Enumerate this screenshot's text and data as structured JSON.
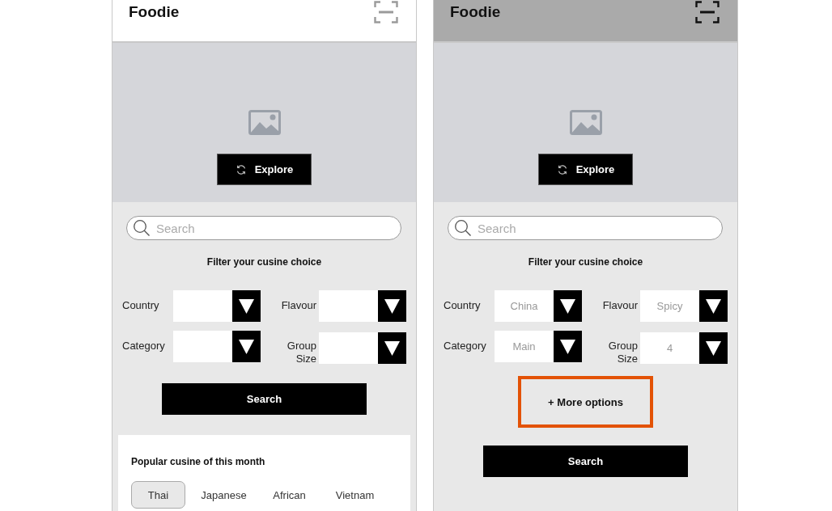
{
  "screens": [
    {
      "header": {
        "title": "Foodie",
        "shaded": false
      },
      "explore_button": "Explore",
      "search": {
        "placeholder": "Search"
      },
      "filter_title": "Filter your cusine choice",
      "filters": [
        {
          "label": "Country"
        },
        {
          "label": "Flavour"
        },
        {
          "label": "Category"
        },
        {
          "label": "Group Size"
        }
      ],
      "search_button": "Search",
      "popular": {
        "title": "Popular cusine of this month",
        "items": [
          {
            "label": "Thai",
            "selected": true
          },
          {
            "label": "Japanese",
            "selected": false
          },
          {
            "label": "African",
            "selected": false
          },
          {
            "label": "Vietnam",
            "selected": false
          }
        ]
      }
    },
    {
      "header": {
        "title": "Foodie",
        "shaded": true
      },
      "explore_button": "Explore",
      "search": {
        "placeholder": "Search"
      },
      "filter_title": "Filter your cusine choice",
      "filters": [
        {
          "label": "Country",
          "value": "China"
        },
        {
          "label": "Flavour",
          "value": "Spicy"
        },
        {
          "label": "Category",
          "value": "Main"
        },
        {
          "label": "Group Size",
          "value": "4"
        }
      ],
      "more_options": {
        "label": "+ More options",
        "highlighted": true
      },
      "search_button": "Search"
    }
  ]
}
